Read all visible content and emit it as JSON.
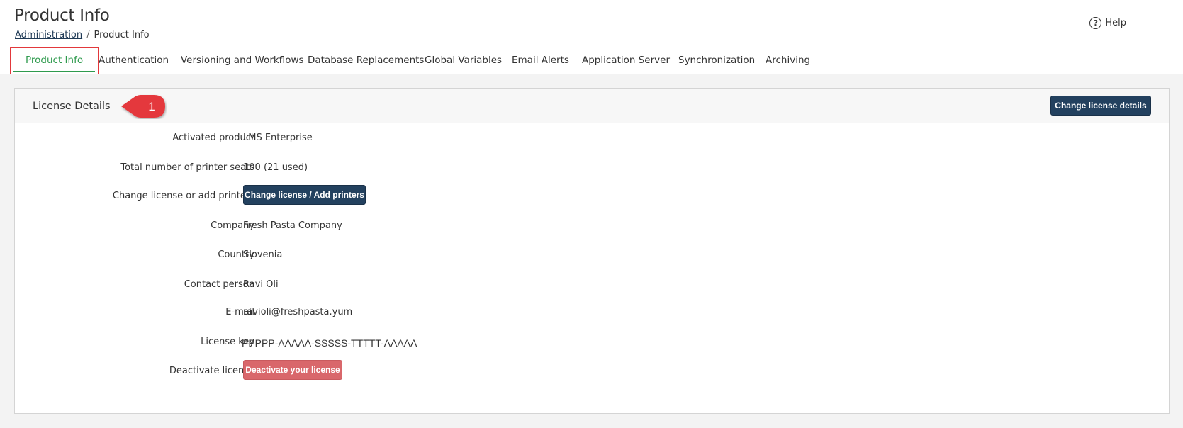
{
  "header": {
    "title": "Product Info",
    "breadcrumb": {
      "parent": "Administration",
      "separator": "/",
      "current": "Product Info"
    },
    "help_label": "Help",
    "help_icon": "question-circle-icon"
  },
  "tabs": [
    {
      "label": "Product Info",
      "active": true
    },
    {
      "label": "Authentication",
      "active": false
    },
    {
      "label": "Versioning and Workflows",
      "active": false
    },
    {
      "label": "Database Replacements",
      "active": false
    },
    {
      "label": "Global Variables",
      "active": false
    },
    {
      "label": "Email Alerts",
      "active": false
    },
    {
      "label": "Application Server",
      "active": false
    },
    {
      "label": "Synchronization",
      "active": false
    },
    {
      "label": "Archiving",
      "active": false
    }
  ],
  "card": {
    "title": "License Details",
    "callout_number": "1",
    "change_details_label": "Change license details",
    "rows": {
      "activated_product": {
        "label": "Activated product",
        "value": "LMS Enterprise"
      },
      "printer_seats": {
        "label": "Total number of printer seats",
        "value": "100 (21 used)"
      },
      "change_license": {
        "label": "Change license or add printers",
        "button": "Change license / Add printers"
      },
      "company": {
        "label": "Company",
        "value": "Fresh Pasta Company"
      },
      "country": {
        "label": "Country",
        "value": "Slovenia"
      },
      "contact": {
        "label": "Contact person",
        "value": "Ravi Oli"
      },
      "email": {
        "label": "E-mail",
        "value": "ravioli@freshpasta.yum"
      },
      "license_key": {
        "label": "License key",
        "value": "PPPPP-AAAAA-SSSSS-TTTTT-AAAAA"
      },
      "deactivate": {
        "label": "Deactivate license",
        "button": "Deactivate your license"
      }
    }
  },
  "colors": {
    "accent_green": "#2e9a4d",
    "primary_button": "#23415f",
    "danger_button": "#d9676b",
    "highlight_red": "#e2383b"
  }
}
